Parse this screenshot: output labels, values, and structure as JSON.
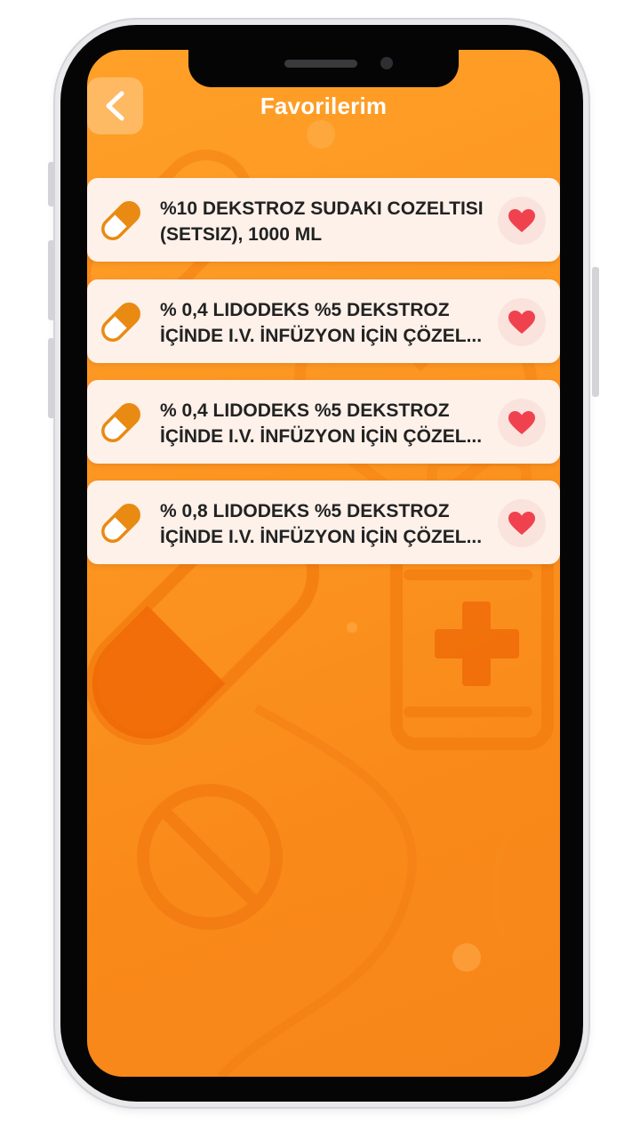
{
  "header": {
    "title": "Favorilerim",
    "back_icon": "chevron-left-icon"
  },
  "favorites": [
    {
      "line1": "%10 DEKSTROZ SUDAKI COZELTISI",
      "line2": "(SETSIZ), 1000 ML",
      "icon": "pill-icon",
      "favorite_icon": "heart-icon"
    },
    {
      "line1": "% 0,4 LIDODEKS %5 DEKSTROZ",
      "line2": "İÇİNDE I.V. İNFÜZYON İÇİN ÇÖZEL...",
      "icon": "pill-icon",
      "favorite_icon": "heart-icon"
    },
    {
      "line1": "% 0,4 LIDODEKS %5 DEKSTROZ",
      "line2": "İÇİNDE I.V. İNFÜZYON İÇİN ÇÖZEL...",
      "icon": "pill-icon",
      "favorite_icon": "heart-icon"
    },
    {
      "line1": "% 0,8 LIDODEKS %5 DEKSTROZ",
      "line2": "İÇİNDE I.V. İNFÜZYON İÇİN ÇÖZEL...",
      "icon": "pill-icon",
      "favorite_icon": "heart-icon"
    }
  ],
  "colors": {
    "background_orange": "#fc9521",
    "card_background": "#fdf1ea",
    "pill_orange": "#e98a12",
    "heart_red": "#f0424e",
    "heart_circle": "#fbe3dd"
  }
}
